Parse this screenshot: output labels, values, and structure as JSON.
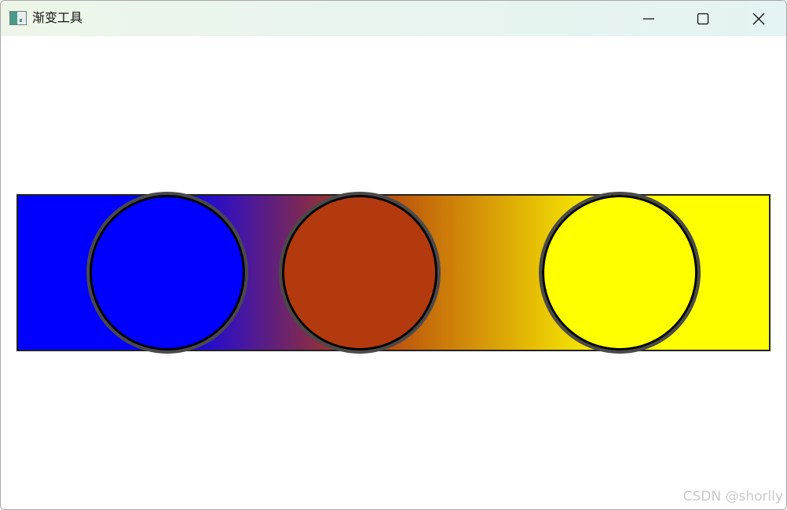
{
  "window": {
    "title": "渐变工具",
    "controls": {
      "minimize_icon": "minimize-icon",
      "maximize_icon": "maximize-icon",
      "close_icon": "close-icon"
    }
  },
  "gradient": {
    "colors": [
      "#0000ff",
      "#0000ff",
      "#b23a0e",
      "#ffff00",
      "#ffff00"
    ],
    "stops": [
      {
        "color": "#0000ff",
        "position": 0.2
      },
      {
        "color": "#b23a0e",
        "position": 0.455
      },
      {
        "color": "#ffff00",
        "position": 0.8
      }
    ]
  },
  "watermark": "CSDN @shorlly"
}
